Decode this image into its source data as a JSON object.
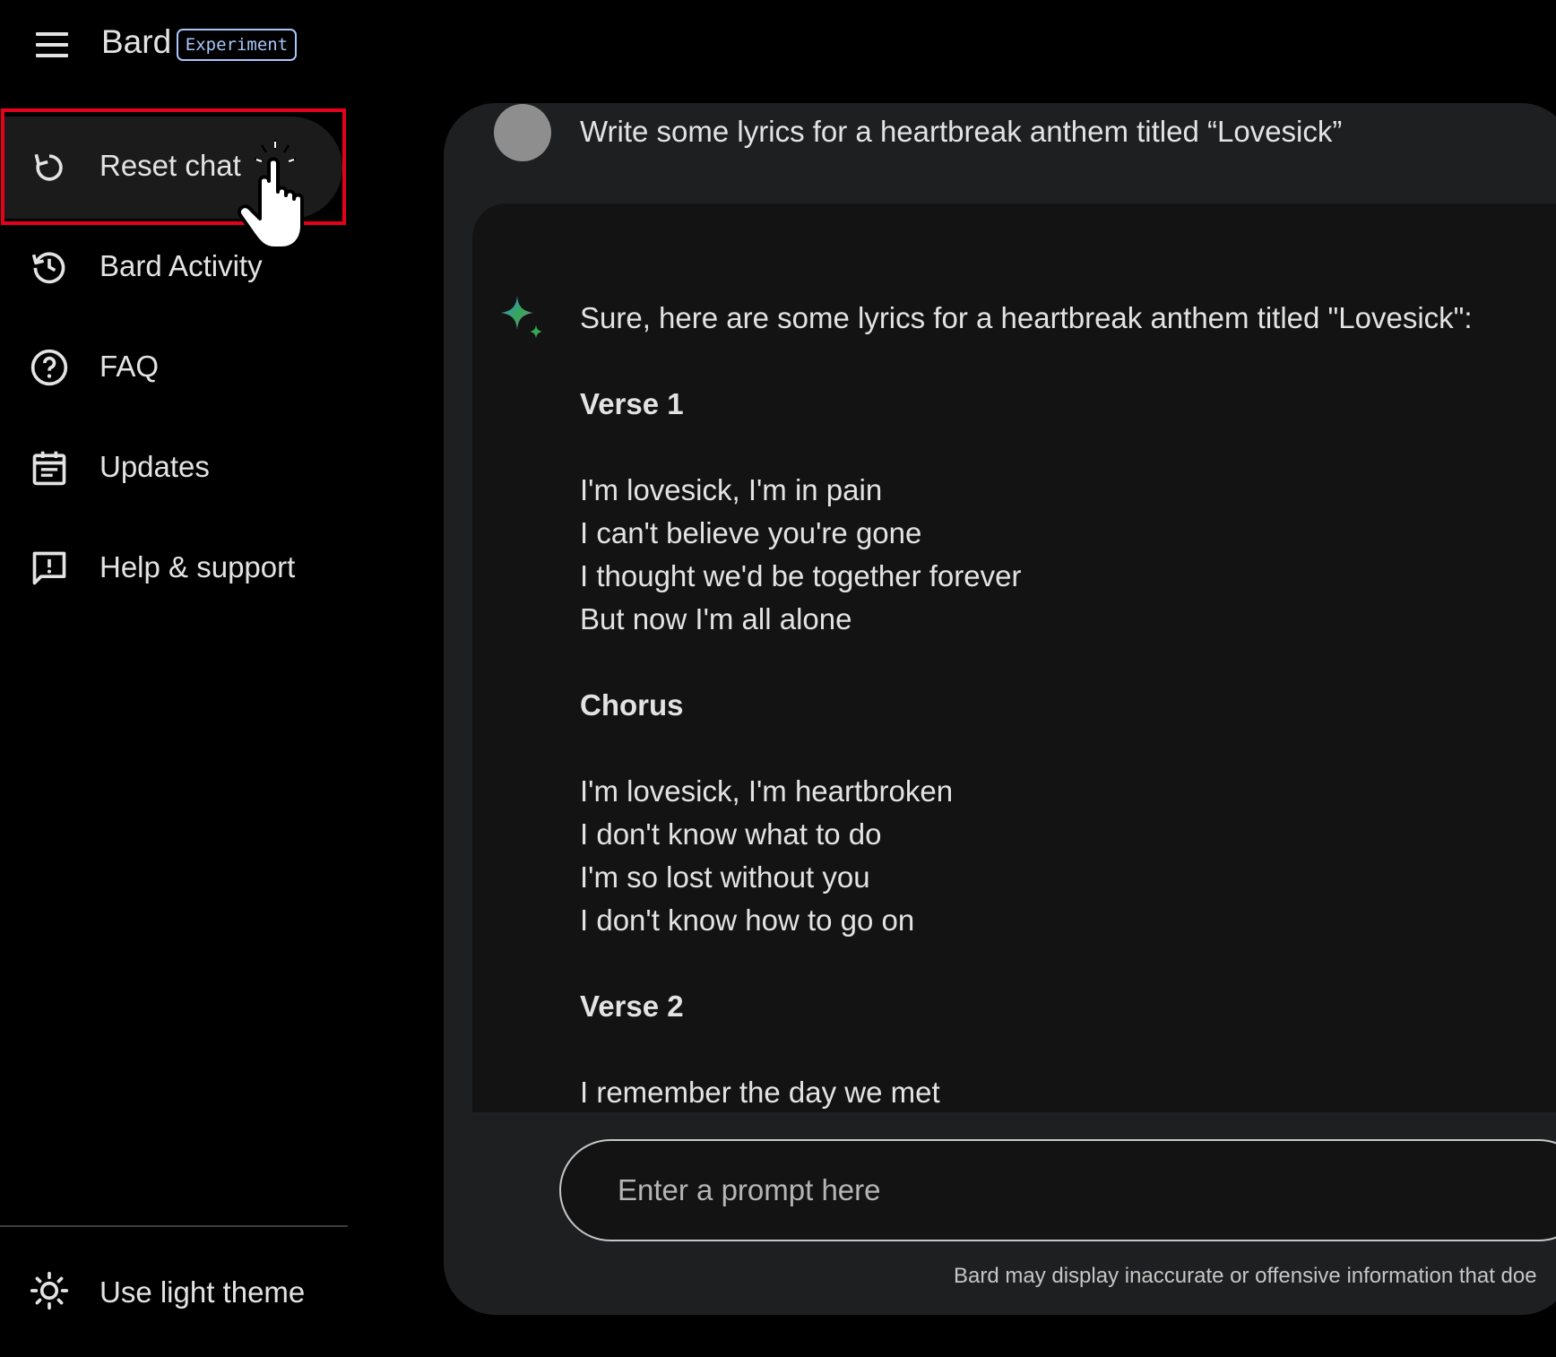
{
  "header": {
    "brand": "Bard",
    "badge": "Experiment",
    "menu_icon": "hamburger-menu-icon"
  },
  "sidebar": {
    "items": [
      {
        "label": "Reset chat",
        "icon": "reset-icon",
        "active": true
      },
      {
        "label": "Bard Activity",
        "icon": "history-icon"
      },
      {
        "label": "FAQ",
        "icon": "help-circle-icon"
      },
      {
        "label": "Updates",
        "icon": "calendar-icon"
      },
      {
        "label": "Help & support",
        "icon": "feedback-icon"
      }
    ],
    "theme_toggle": {
      "label": "Use light theme",
      "icon": "sun-icon"
    }
  },
  "chat": {
    "user_prompt": "Write some lyrics for a heartbreak anthem titled “Lovesick”",
    "response": {
      "intro": "Sure, here are some lyrics for a heartbreak anthem titled \"Lovesick\":",
      "verse1_heading": "Verse 1",
      "verse1_lines": [
        "I'm lovesick, I'm in pain",
        "I can't believe you're gone",
        "I thought we'd be together forever",
        "But now I'm all alone"
      ],
      "chorus_heading": "Chorus",
      "chorus_lines": [
        "I'm lovesick, I'm heartbroken",
        "I don't know what to do",
        "I'm so lost without you",
        "I don't know how to go on"
      ],
      "verse2_heading": "Verse 2",
      "verse2_lines": [
        "I remember the day we met"
      ]
    }
  },
  "input": {
    "placeholder": "Enter a prompt here",
    "disclaimer": "Bard may display inaccurate or offensive information that doe"
  },
  "colors": {
    "background": "#000000",
    "panel": "#1e1f20",
    "card": "#131314",
    "badge": "#a8c7fa",
    "highlight": "#e5001b"
  }
}
